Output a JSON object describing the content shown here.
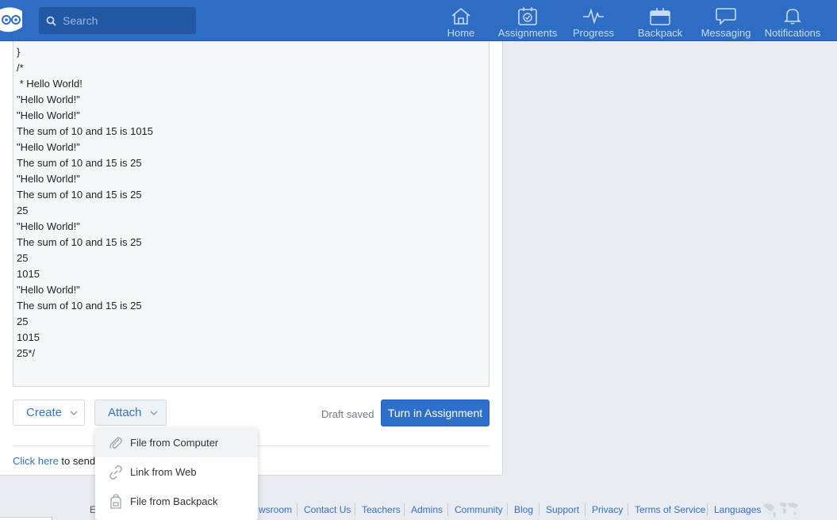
{
  "search": {
    "placeholder": "Search"
  },
  "nav": [
    {
      "label": "Home",
      "icon": "home-icon"
    },
    {
      "label": "Assignments",
      "icon": "assignments-icon"
    },
    {
      "label": "Progress",
      "icon": "progress-icon"
    },
    {
      "label": "Backpack",
      "icon": "backpack-icon"
    },
    {
      "label": "Messaging",
      "icon": "messaging-icon"
    },
    {
      "label": "Notifications",
      "icon": "notifications-icon"
    }
  ],
  "editor": {
    "lines": [
      "}",
      "/*",
      " * Hello World!",
      "\"Hello World!\"",
      "\"Hello World!\"",
      "The sum of 10 and 15 is 1015",
      "\"Hello World!\"",
      "The sum of 10 and 15 is 25",
      "\"Hello World!\"",
      "The sum of 10 and 15 is 25",
      "25",
      "\"Hello World!\"",
      "The sum of 10 and 15 is 25",
      "25",
      "1015",
      "\"Hello World!\"",
      "The sum of 10 and 15 is 25",
      "25",
      "1015",
      "25*/"
    ]
  },
  "toolbar": {
    "create_label": "Create",
    "attach_label": "Attach",
    "draft_status": "Draft saved",
    "turnin_label": "Turn in Assignment"
  },
  "footer_note": {
    "link": "Click here",
    "text": " to send"
  },
  "attach_menu": [
    {
      "label": "File from Computer",
      "icon": "paperclip-icon"
    },
    {
      "label": "Link from Web",
      "icon": "link-icon"
    },
    {
      "label": "File from Backpack",
      "icon": "backpack-icon"
    }
  ],
  "footer": {
    "partial_left": "E",
    "links": [
      "wsroom",
      "Contact Us",
      "Teachers",
      "Admins",
      "Community",
      "Blog",
      "Support",
      "Privacy",
      "Terms of Service",
      "Languages"
    ]
  },
  "colors": {
    "brand": "#2d6ec4",
    "link": "#3471c8",
    "primary_button": "#2e6fcc"
  }
}
